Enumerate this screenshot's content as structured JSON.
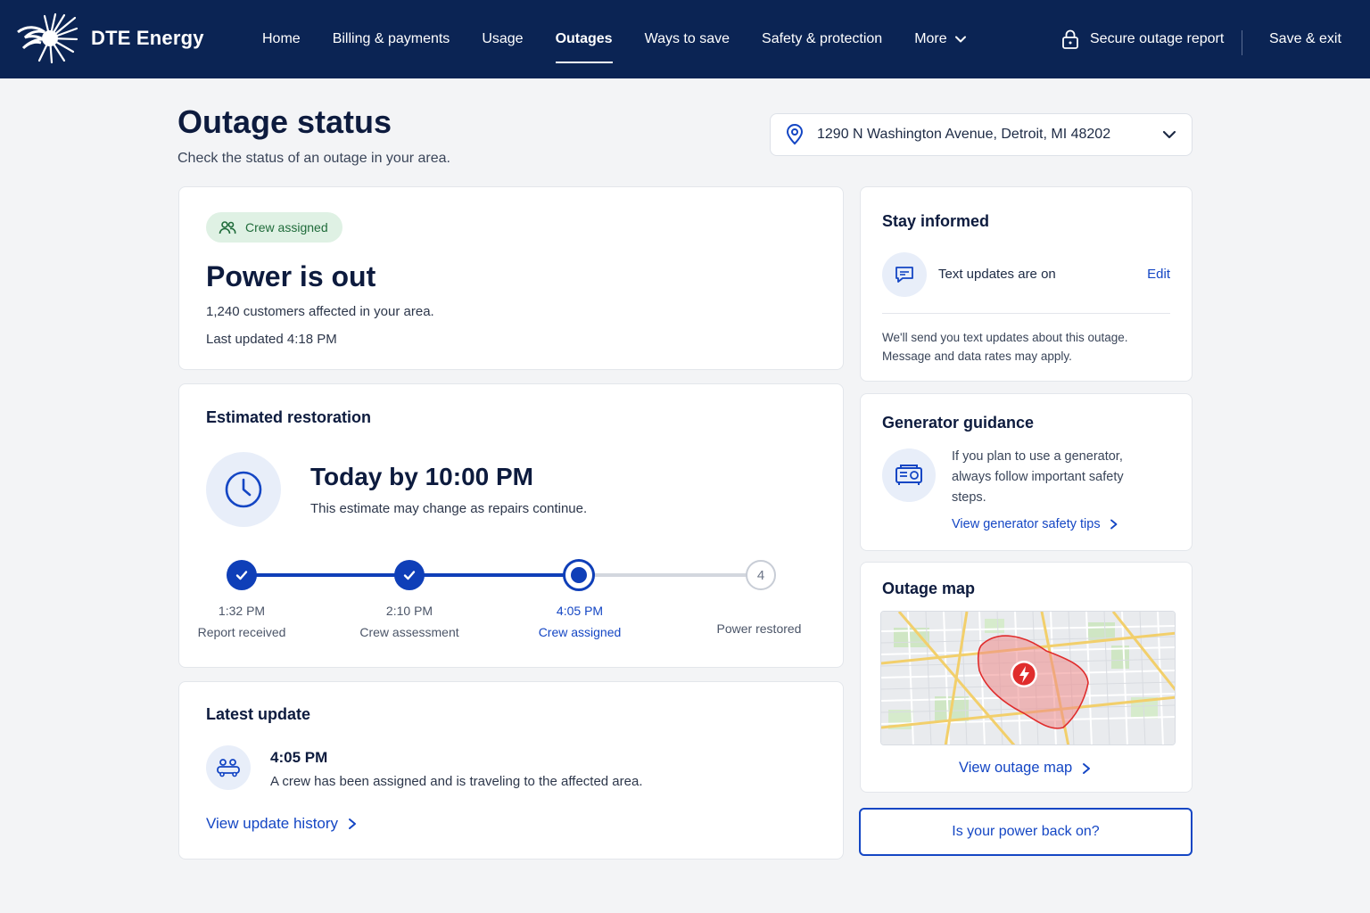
{
  "brand": {
    "name": "DTE Energy"
  },
  "nav": {
    "items": [
      {
        "label": "Home"
      },
      {
        "label": "Billing & payments"
      },
      {
        "label": "Usage"
      },
      {
        "label": "Outages"
      },
      {
        "label": "Ways to save"
      },
      {
        "label": "Safety & protection"
      },
      {
        "label": "More"
      }
    ],
    "active_index": 3,
    "secure_label": "Secure outage report",
    "save_exit_label": "Save & exit"
  },
  "header": {
    "title": "Outage status",
    "subtitle": "Check the status of an outage in your area.",
    "address": "1290 N Washington Avenue, Detroit, MI 48202"
  },
  "status": {
    "badge": "Crew assigned",
    "headline": "Power is out",
    "affected": "1,240 customers affected in your area.",
    "updated": "Last updated 4:18 PM"
  },
  "restoration": {
    "title": "Estimated restoration",
    "eta": "Today by 10:00 PM",
    "note": "This estimate may change as repairs continue.",
    "steps": [
      {
        "time": "1:32 PM",
        "label": "Report received",
        "state": "done"
      },
      {
        "time": "2:10 PM",
        "label": "Crew assessment",
        "state": "done"
      },
      {
        "time": "4:05 PM",
        "label": "Crew assigned",
        "state": "current"
      },
      {
        "time": "",
        "label": "Power restored",
        "state": "future",
        "number": "4"
      }
    ]
  },
  "latest": {
    "title": "Latest update",
    "time": "4:05 PM",
    "text": "A crew has been assigned and is traveling to the affected area.",
    "link": "View update history"
  },
  "informed": {
    "title": "Stay informed",
    "status": "Text updates are on",
    "edit": "Edit",
    "note_line1": "We'll send you text updates about this outage.",
    "note_line2": "Message and data rates may apply."
  },
  "generator": {
    "title": "Generator guidance",
    "line1": "If you plan to use a generator,",
    "line2": "always follow important safety",
    "line3": "steps.",
    "link": "View generator safety tips"
  },
  "map": {
    "title": "Outage map",
    "link": "View outage map"
  },
  "cta": {
    "label": "Is your power back on?"
  },
  "colors": {
    "nav_bg": "#0b2454",
    "accent": "#1446c4",
    "progress": "#0f3fb8",
    "badge_bg": "#dff1e4",
    "badge_fg": "#1f6b3a",
    "outage_red": "#e02c2c"
  }
}
